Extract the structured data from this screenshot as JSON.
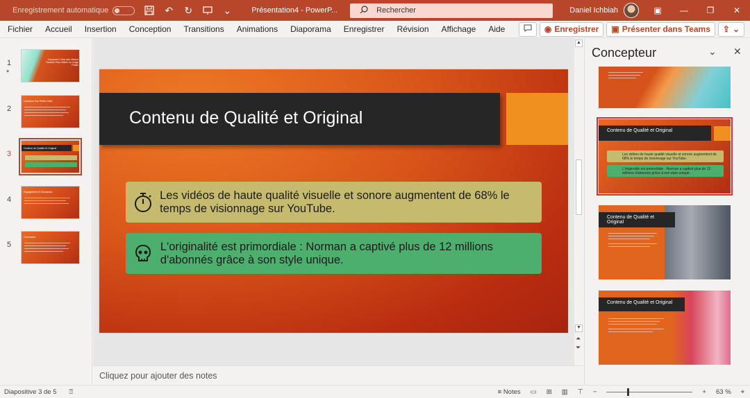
{
  "titlebar": {
    "autosave_label": "Enregistrement automatique",
    "document_title": "Présentation4  -  PowerP...",
    "search_placeholder": "Rechercher",
    "user_name": "Daniel Ichbiah"
  },
  "menu": {
    "items": [
      "Fichier",
      "Accueil",
      "Insertion",
      "Conception",
      "Transitions",
      "Animations",
      "Diaporama",
      "Enregistrer",
      "Révision",
      "Affichage",
      "Aide"
    ],
    "save_button": "Enregistrer",
    "teams_button": "Présenter dans Teams"
  },
  "thumbnails": [
    {
      "number": "1",
      "starred": true,
      "mini_title": "Comment Créer des Vidéos Youtube Pour Attirer un Large Public",
      "selected": false
    },
    {
      "number": "2",
      "starred": false,
      "mini_title": "Constitue Son Public Cible",
      "selected": false
    },
    {
      "number": "3",
      "starred": false,
      "mini_title": "Contenu de Qualité et Original",
      "selected": true
    },
    {
      "number": "4",
      "starred": false,
      "mini_title": "Engagement et Constance",
      "selected": false
    },
    {
      "number": "5",
      "starred": false,
      "mini_title": "Conclusion",
      "selected": false
    }
  ],
  "slide": {
    "title": "Contenu de Qualité et Original",
    "card1_text": "Les vidéos de haute qualité visuelle et sonore augmentent de 68% le temps de visionnage sur YouTube.",
    "card2_text": "L'originalité est primordiale : Norman a captivé plus de 12 millions d'abonnés grâce à son style unique.",
    "colors": {
      "title_bar": "#262626",
      "accent": "#f0901e",
      "card1": "#c6ba6e",
      "card2": "#4caf6e"
    }
  },
  "notes_placeholder": "Cliquez pour ajouter des notes",
  "designer": {
    "title": "Concepteur",
    "option1_title": "Contenu de Qualité et Original",
    "option1_text1": "Les vidéos de haute qualité visuelle et sonore augmentent de 68% le temps de visionnage sur YouTube.",
    "option1_text2": "L'originalité est primordiale : Norman a captivé plus de 12 millions d'abonnés grâce à son style unique.",
    "option2_title": "Contenu de Qualité et Original",
    "option3_title": "Contenu de Qualité et Original"
  },
  "status": {
    "slide_info": "Diapositive 3 de 5",
    "notes_label": "Notes",
    "zoom": "63 %"
  },
  "icons": [
    "save-icon",
    "undo-icon",
    "redo-icon",
    "present-icon",
    "search-icon",
    "comment-icon",
    "record-icon",
    "teams-icon",
    "share-icon",
    "stopwatch-icon",
    "skull-icon",
    "chevron-down-icon",
    "close-icon"
  ]
}
